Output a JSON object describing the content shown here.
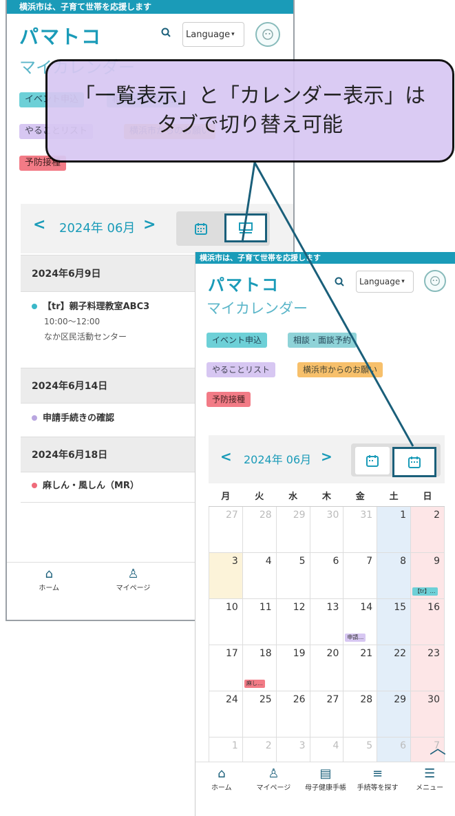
{
  "banner": "横浜市は、子育て世帯を応援します",
  "app_name": "パマトコ",
  "language_label": "Language",
  "my_calendar": "マイカレンダー",
  "tags": {
    "event": "イベント申込",
    "consult": "相談・面談予約",
    "todo": "やることリスト",
    "request": "横浜市からのお願い",
    "vaccination": "予防接種"
  },
  "month_label": "2024年 06月",
  "list_view": {
    "days": [
      {
        "date": "2024年6月9日",
        "items": [
          {
            "title": "【tr】親子料理教室ABC3",
            "time": "10:00〜12:00",
            "place": "なか区民活動センター",
            "color": "#3bb8c9"
          }
        ]
      },
      {
        "date": "2024年6月14日",
        "items": [
          {
            "title": "申請手続きの確認",
            "color": "#b9a6e0"
          }
        ]
      },
      {
        "date": "2024年6月18日",
        "items": [
          {
            "title": "麻しん・風しん（MR）",
            "color": "#ef6b7a"
          }
        ]
      }
    ]
  },
  "calendar": {
    "weekdays": [
      "月",
      "火",
      "水",
      "木",
      "金",
      "土",
      "日"
    ],
    "weeks": [
      [
        "27",
        "28",
        "29",
        "30",
        "31",
        "1",
        "2"
      ],
      [
        "3",
        "4",
        "5",
        "6",
        "7",
        "8",
        "9"
      ],
      [
        "10",
        "11",
        "12",
        "13",
        "14",
        "15",
        "16"
      ],
      [
        "17",
        "18",
        "19",
        "20",
        "21",
        "22",
        "23"
      ],
      [
        "24",
        "25",
        "26",
        "27",
        "28",
        "29",
        "30"
      ],
      [
        "1",
        "2",
        "3",
        "4",
        "5",
        "6",
        "7"
      ]
    ],
    "events": {
      "9": "【tr】…",
      "14": "申請…",
      "18": "麻し…"
    }
  },
  "bottom_nav": {
    "home": "ホーム",
    "mypage": "マイページ",
    "handbook": "母子健康手帳",
    "procedures": "手続等を探す",
    "procedures_cut": "手続",
    "menu": "メニュー"
  },
  "callout_text": "「一覧表示」と「カレンダー表示」はタブで切り替え可能",
  "colors": {
    "brand": "#1a9bb8",
    "accent_dark": "#1a5f7a",
    "callout_bg": "#d7c7f2"
  }
}
